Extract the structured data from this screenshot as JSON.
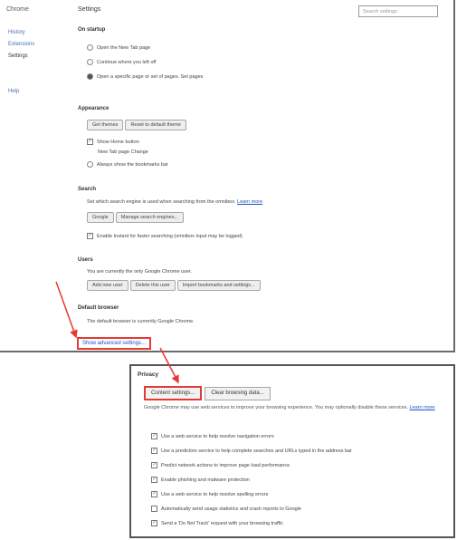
{
  "sidebar": {
    "title": "Chrome",
    "items": [
      "History",
      "Extensions",
      "Settings",
      "Help"
    ]
  },
  "header": {
    "title": "Settings",
    "search_placeholder": "Search settings"
  },
  "sections": {
    "on_startup": {
      "heading": "On startup",
      "options": [
        "Open the New Tab page",
        "Continue where you left off",
        "Open a specific page or set of pages. Set pages"
      ]
    },
    "appearance": {
      "heading": "Appearance",
      "buttons": [
        "Get themes",
        "Reset to default theme"
      ],
      "options": [
        "Show Home button",
        "New Tab page Change",
        "Always show the bookmarks bar"
      ]
    },
    "search": {
      "heading": "Search",
      "description": "Set which search engine is used when searching from the omnibox.",
      "link": "Learn more",
      "buttons": [
        "Google",
        "Manage search engines..."
      ],
      "option": "Enable Instant for faster searching (omnibox input may be logged)"
    },
    "users": {
      "heading": "Users",
      "description": "You are currently the only Google Chrome user.",
      "buttons": [
        "Add new user",
        "Delete this user",
        "Import bookmarks and settings..."
      ]
    },
    "default_browser": {
      "heading": "Default browser",
      "text": "The default browser is currently Google Chrome."
    }
  },
  "advanced_link": "Show advanced settings...",
  "privacy": {
    "heading": "Privacy",
    "buttons": [
      "Content settings...",
      "Clear browsing data..."
    ],
    "description": "Google Chrome may use web services to improve your browsing experience. You may optionally disable these services.",
    "learn_more": "Learn more",
    "options": [
      {
        "label": "Use a web service to help resolve navigation errors",
        "checked": true
      },
      {
        "label": "Use a prediction service to help complete searches and URLs typed in the address bar",
        "checked": true
      },
      {
        "label": "Predict network actions to improve page load performance",
        "checked": true
      },
      {
        "label": "Enable phishing and malware protection",
        "checked": true
      },
      {
        "label": "Use a web service to help resolve spelling errors",
        "checked": true
      },
      {
        "label": "Automatically send usage statistics and crash reports to Google",
        "checked": false
      },
      {
        "label": "Send a 'Do Not Track' request with your browsing traffic",
        "checked": true
      }
    ]
  },
  "colors": {
    "annotation": "#e53935",
    "link": "#1a55c0"
  }
}
